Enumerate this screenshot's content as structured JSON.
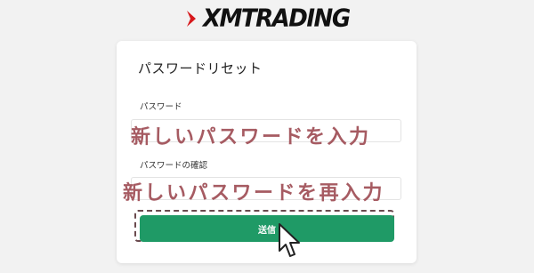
{
  "logo": {
    "text": "XMTRADING"
  },
  "card": {
    "title": "パスワードリセット",
    "password_label": "パスワード",
    "confirm_label": "パスワードの確認",
    "password_overlay": "新しいパスワードを入力",
    "confirm_overlay": "新しいパスワードを再入力",
    "submit_label": "送信"
  },
  "colors": {
    "accent": "#1f9a66",
    "overlay": "#a65b62",
    "logo_red": "#d7191c"
  },
  "icons": {
    "logo_mark": "xm-logo-mark-icon",
    "cursor": "mouse-pointer-icon"
  }
}
